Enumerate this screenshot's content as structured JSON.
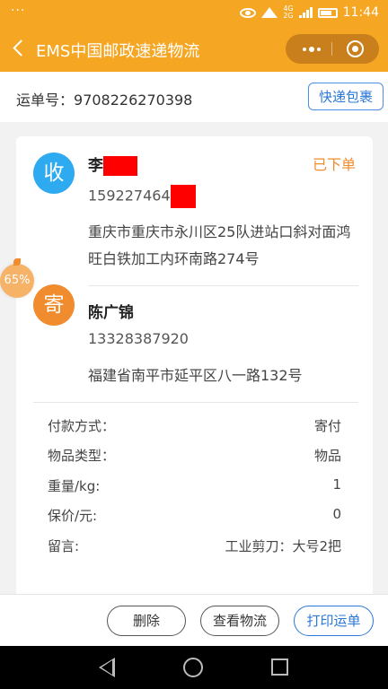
{
  "statusbar": {
    "dots": "···",
    "network_top": "4G",
    "network_bottom": "2G",
    "time": "11:44"
  },
  "navbar": {
    "title": "EMS中国邮政速递物流"
  },
  "waybill": {
    "label": "运单号：",
    "number": "9708226270398",
    "package_button": "快递包裹"
  },
  "receiver": {
    "avatar_char": "收",
    "name": "李",
    "phone": "159227464",
    "address": "重庆市重庆市永川区25队进站口斜对面鸿旺白铁加工内环南路274号"
  },
  "order_status": "已下单",
  "sender": {
    "avatar_char": "寄",
    "name": "陈广锦",
    "phone": "13328387920",
    "address": "福建省南平市延平区八一路132号"
  },
  "details": [
    {
      "key": "付款方式：",
      "value": "寄付"
    },
    {
      "key": "物品类型：",
      "value": "物品"
    },
    {
      "key": "重量/kg:",
      "value": "1"
    },
    {
      "key": "保价/元:",
      "value": "0"
    },
    {
      "key": "留言:",
      "value": "工业剪刀：大号2把"
    }
  ],
  "float_badge": "65%",
  "actions": {
    "delete": "删除",
    "track": "查看物流",
    "print": "打印运单"
  },
  "colors": {
    "brand": "#f5a623",
    "receiver_avatar": "#2eaaf0",
    "sender_avatar": "#f08c2e",
    "link_blue": "#2b78d6",
    "redaction": "#ff0000"
  }
}
